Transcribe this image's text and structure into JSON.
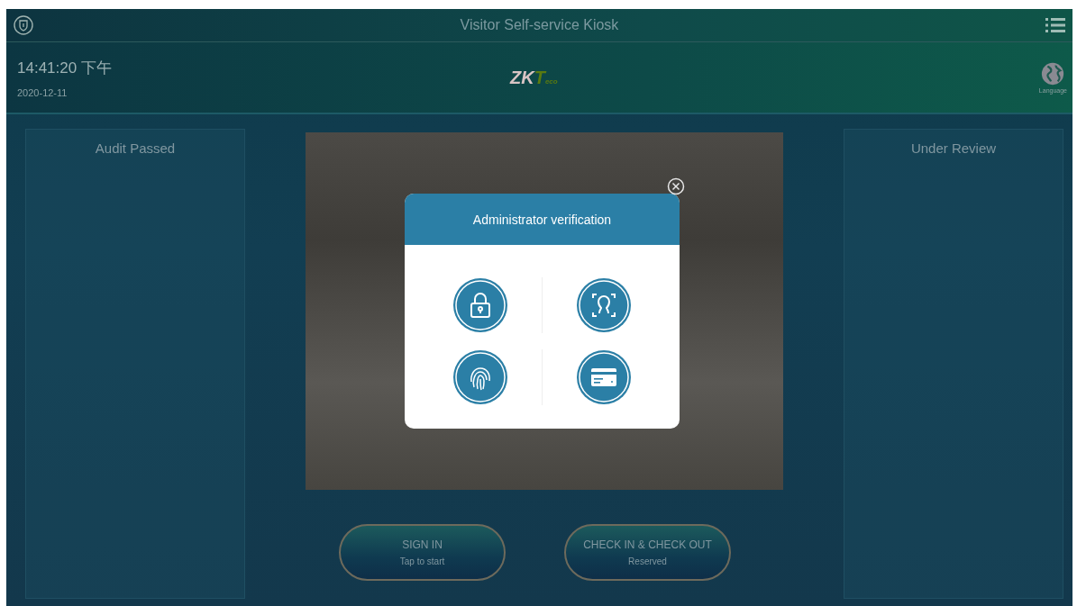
{
  "header": {
    "title": "Visitor Self-service Kiosk"
  },
  "info_bar": {
    "time": "14:41:20 下午",
    "date": "2020-12-11",
    "logo": {
      "main": "ZK",
      "accent": "T",
      "suffix": "eco"
    },
    "language_label": "Language"
  },
  "panels": [
    {
      "title": "Audit Passed"
    },
    {
      "title": "Under Review"
    }
  ],
  "actions": [
    {
      "label": "SIGN IN",
      "sublabel": "Tap to start"
    },
    {
      "label": "CHECK IN & CHECK OUT",
      "sublabel": "Reserved"
    }
  ],
  "dialog": {
    "title": "Administrator verification",
    "methods": [
      {
        "kind": "password"
      },
      {
        "kind": "face"
      },
      {
        "kind": "fingerprint"
      },
      {
        "kind": "card"
      }
    ]
  }
}
